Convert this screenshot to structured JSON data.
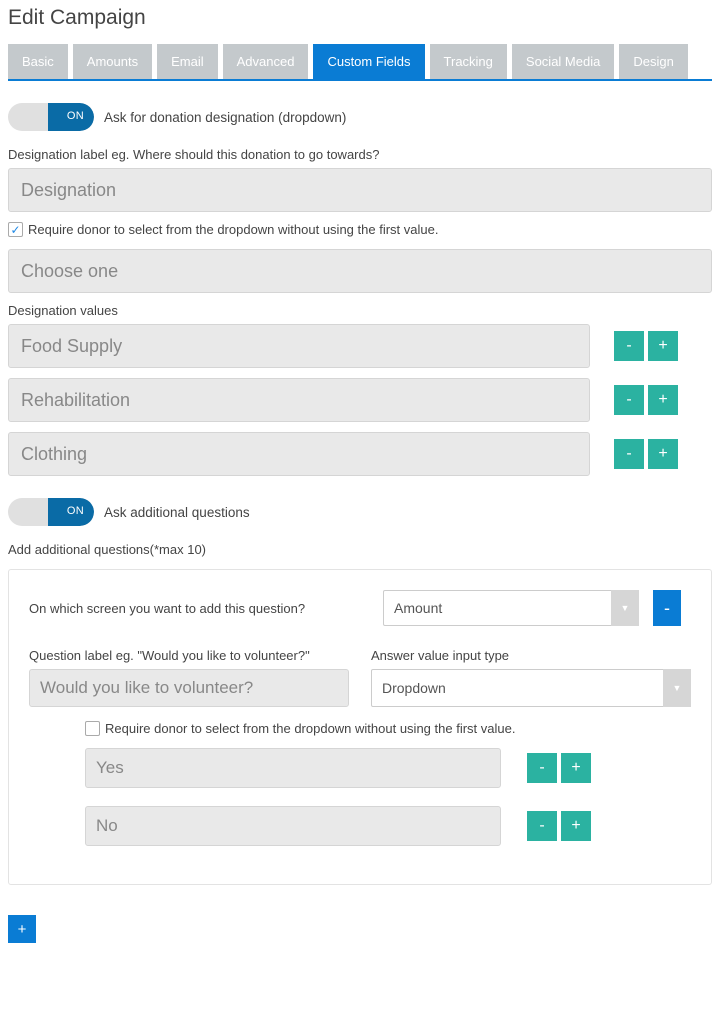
{
  "title": "Edit Campaign",
  "tabs": [
    {
      "label": "Basic",
      "active": false
    },
    {
      "label": "Amounts",
      "active": false
    },
    {
      "label": "Email",
      "active": false
    },
    {
      "label": "Advanced",
      "active": false
    },
    {
      "label": "Custom Fields",
      "active": true
    },
    {
      "label": "Tracking",
      "active": false
    },
    {
      "label": "Social Media",
      "active": false
    },
    {
      "label": "Design",
      "active": false
    }
  ],
  "toggle": {
    "on_label": "ON"
  },
  "designation": {
    "toggle_text": "Ask for donation designation (dropdown)",
    "label_text": "Designation label eg. Where should this donation to go towards?",
    "label_value": "Designation",
    "require_text": "Require donor to select from the dropdown without using the first value.",
    "require_checked": true,
    "first_value": "Choose one",
    "values_label": "Designation values",
    "values": [
      "Food Supply",
      "Rehabilitation",
      "Clothing"
    ]
  },
  "additional": {
    "toggle_text": "Ask additional questions",
    "heading": "Add additional questions(*max 10)",
    "question": {
      "screen_label": "On which screen you want to add this question?",
      "screen_value": "Amount",
      "q_label": "Question label eg. \"Would you like to volunteer?\"",
      "q_value": "Would you like to volunteer?",
      "type_label": "Answer value input type",
      "type_value": "Dropdown",
      "require_text": "Require donor to select from the dropdown without using the first value.",
      "require_checked": false,
      "answers": [
        "Yes",
        "No"
      ]
    }
  },
  "buttons": {
    "minus": "-",
    "plus": "+"
  }
}
